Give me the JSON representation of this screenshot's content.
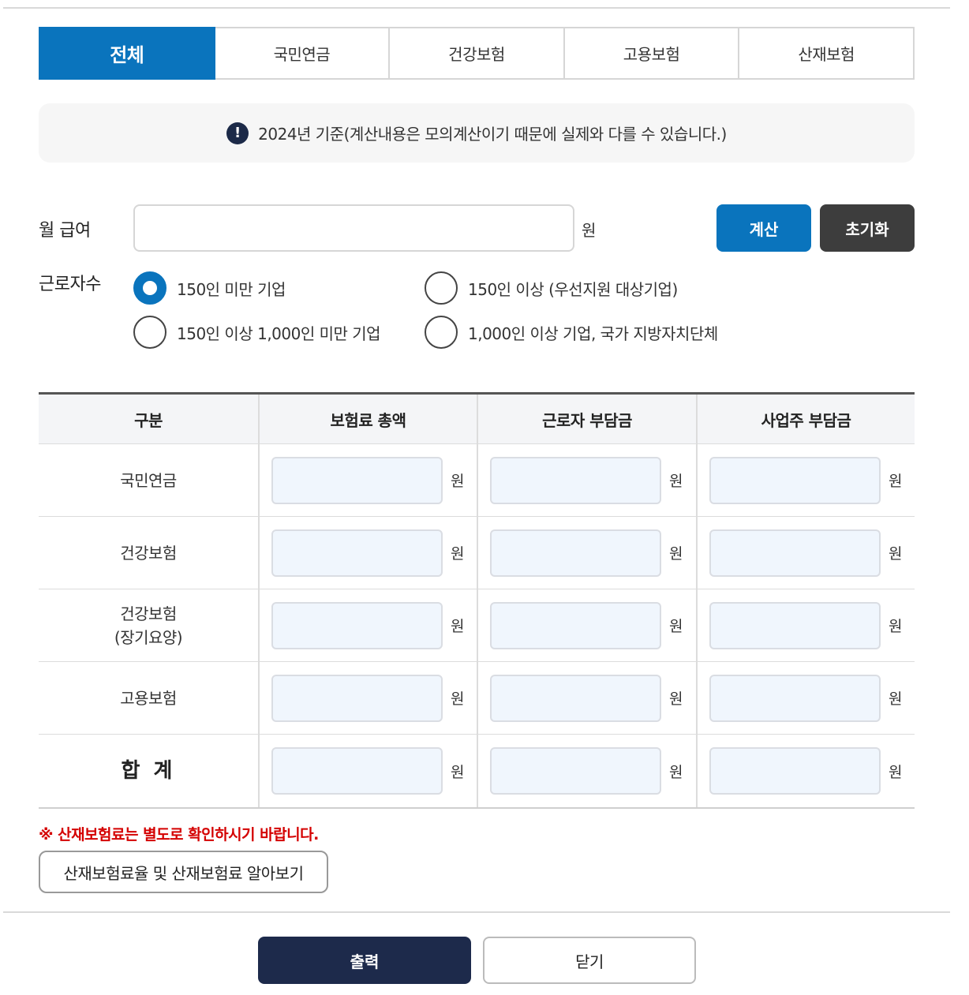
{
  "tabs": [
    {
      "label": "전체",
      "active": true
    },
    {
      "label": "국민연금",
      "active": false
    },
    {
      "label": "건강보험",
      "active": false
    },
    {
      "label": "고용보험",
      "active": false
    },
    {
      "label": "산재보험",
      "active": false
    }
  ],
  "notice": {
    "icon": "!",
    "text": "2024년 기준(계산내용은 모의계산이기 때문에 실제와 다를 수 있습니다.)"
  },
  "salary": {
    "label": "월 급여",
    "value": "",
    "unit": "원"
  },
  "buttons": {
    "calculate": "계산",
    "reset": "초기화",
    "print": "출력",
    "close": "닫기"
  },
  "workers": {
    "label": "근로자수",
    "options": [
      {
        "label": "150인 미만 기업",
        "checked": true
      },
      {
        "label": "150인 이상 (우선지원 대상기업)",
        "checked": false
      },
      {
        "label": "150인 이상 1,000인 미만 기업",
        "checked": false
      },
      {
        "label": "1,000인 이상 기업, 국가 지방자치단체",
        "checked": false
      }
    ]
  },
  "table": {
    "headers": [
      "구분",
      "보험료 총액",
      "근로자 부담금",
      "사업주 부담금"
    ],
    "unit": "원",
    "rows": [
      {
        "label": "국민연금",
        "sublabel": ""
      },
      {
        "label": "건강보험",
        "sublabel": ""
      },
      {
        "label": "건강보험",
        "sublabel": "(장기요양)"
      },
      {
        "label": "고용보험",
        "sublabel": ""
      },
      {
        "label": "합 계",
        "sublabel": ""
      }
    ]
  },
  "warning": "※ 산재보험료는 별도로 확인하시기 바랍니다.",
  "link_button": "산재보험료율 및 산재보험료 알아보기",
  "colors": {
    "primary": "#0a74bd",
    "dark": "#3d3d3d",
    "navy": "#1d2a4b",
    "warning": "#d40000"
  }
}
